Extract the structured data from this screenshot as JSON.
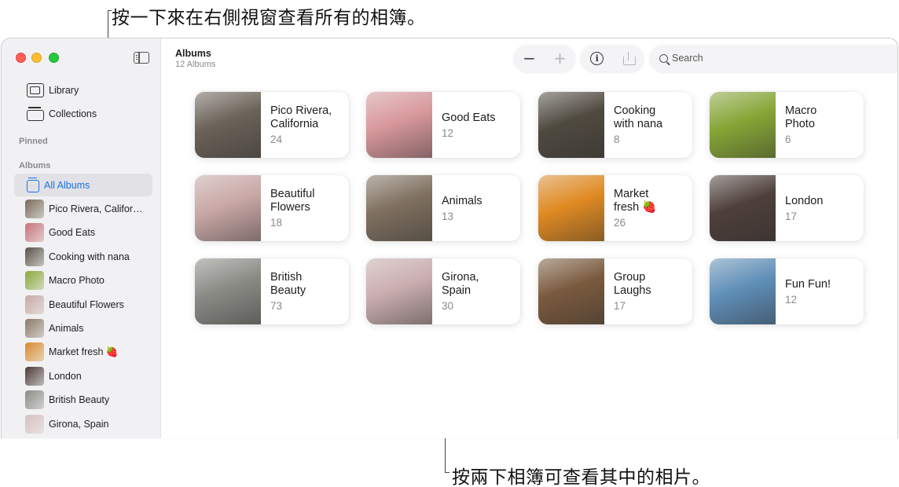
{
  "callouts": {
    "top": "按一下來在右側視窗查看所有的相簿。",
    "bottom": "按兩下相簿可查看其中的相片。"
  },
  "sidebar": {
    "library": "Library",
    "collections": "Collections",
    "pinned_label": "Pinned",
    "albums_label": "Albums",
    "all_albums": "All Albums",
    "albums": [
      {
        "label": "Pico Rivera, California",
        "color": "#7a6a5a"
      },
      {
        "label": "Good Eats",
        "color": "#c6727a"
      },
      {
        "label": "Cooking with nana",
        "color": "#5a5448"
      },
      {
        "label": "Macro Photo",
        "color": "#8aa83a"
      },
      {
        "label": "Beautiful Flowers",
        "color": "#c7a9a6"
      },
      {
        "label": "Animals",
        "color": "#8a7a66"
      },
      {
        "label": "Market fresh 🍓",
        "color": "#d98a2a"
      },
      {
        "label": "London",
        "color": "#4a3a36"
      },
      {
        "label": "British Beauty",
        "color": "#8a8a86"
      },
      {
        "label": "Girona, Spain",
        "color": "#d8c0c0"
      }
    ]
  },
  "toolbar": {
    "title": "Albums",
    "subtitle": "12 Albums",
    "zoom_out": "−",
    "zoom_in": "+",
    "info": "i",
    "search_placeholder": "Search"
  },
  "grid": [
    {
      "name": "Pico Rivera,\nCalifornia",
      "count": "24",
      "color": "#6b6258"
    },
    {
      "name": "Good Eats",
      "count": "12",
      "color": "#d8989c"
    },
    {
      "name": "Cooking\nwith nana",
      "count": "8",
      "color": "#4f4a40"
    },
    {
      "name": "Macro\nPhoto",
      "count": "6",
      "color": "#86a636"
    },
    {
      "name": "Beautiful\nFlowers",
      "count": "18",
      "color": "#c9a8a6"
    },
    {
      "name": "Animals",
      "count": "13",
      "color": "#7f705f"
    },
    {
      "name": "Market\nfresh 🍓",
      "count": "26",
      "color": "#e08a22"
    },
    {
      "name": "London",
      "count": "17",
      "color": "#4e3f3a"
    },
    {
      "name": "British\nBeauty",
      "count": "73",
      "color": "#8b8b86"
    },
    {
      "name": "Girona,\nSpain",
      "count": "30",
      "color": "#caaeb0"
    },
    {
      "name": "Group\nLaughs",
      "count": "17",
      "color": "#7a5a3e"
    },
    {
      "name": "Fun Fun!",
      "count": "12",
      "color": "#5f8fb8"
    }
  ]
}
